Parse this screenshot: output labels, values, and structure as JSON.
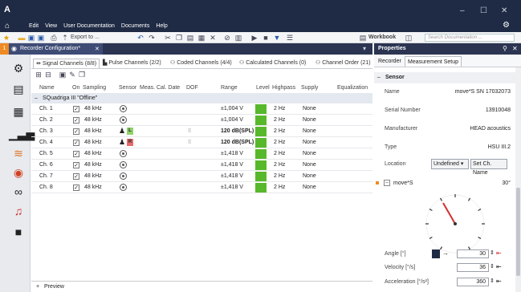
{
  "window": {
    "minimize": "–",
    "maximize": "☐",
    "close": "✕",
    "logo": "A"
  },
  "menu": {
    "items": [
      "Edit",
      "View",
      "User Documentation",
      "Documents",
      "Help"
    ]
  },
  "toolbar": {
    "export_label": "Export to ...",
    "workbook_label": "Workbook",
    "search_placeholder": "Search Documentation ..."
  },
  "doc_tab": {
    "number": "1",
    "title": "Recorder Configuration*",
    "close": "✕"
  },
  "channel_tabs": [
    "Signal Channels (8/8)",
    "Pulse Channels (2/2)",
    "Coded Channels (4/4)",
    "Calculated Channels (0)",
    "Channel Order (21)"
  ],
  "table": {
    "headers": [
      "Name",
      "On",
      "Sampling",
      "Sensor",
      "Meas. Cal. Date",
      "DOF",
      "Range",
      "Level",
      "Highpass",
      "Supply",
      "Equalization"
    ],
    "group": "SQuadriga III \"Offline\"",
    "rows": [
      {
        "name": "Ch. 1",
        "sampling": "48 kHz",
        "range": "±1,004 V",
        "highpass": "2 Hz",
        "supply": "None"
      },
      {
        "name": "Ch. 2",
        "sampling": "48 kHz",
        "range": "±1,004 V",
        "highpass": "2 Hz",
        "supply": "None"
      },
      {
        "name": "Ch. 3",
        "sampling": "48 kHz",
        "range": "120 dB(SPL)",
        "highpass": "2 Hz",
        "supply": "None",
        "badge": "L"
      },
      {
        "name": "Ch. 4",
        "sampling": "48 kHz",
        "range": "120 dB(SPL)",
        "highpass": "2 Hz",
        "supply": "None",
        "badge": "R"
      },
      {
        "name": "Ch. 5",
        "sampling": "48 kHz",
        "range": "±1,418 V",
        "highpass": "2 Hz",
        "supply": "None"
      },
      {
        "name": "Ch. 6",
        "sampling": "48 kHz",
        "range": "±1,418 V",
        "highpass": "2 Hz",
        "supply": "None"
      },
      {
        "name": "Ch. 7",
        "sampling": "48 kHz",
        "range": "±1,418 V",
        "highpass": "2 Hz",
        "supply": "None"
      },
      {
        "name": "Ch. 8",
        "sampling": "48 kHz",
        "range": "±1,418 V",
        "highpass": "2 Hz",
        "supply": "None"
      }
    ]
  },
  "preview_label": "Preview",
  "properties": {
    "title": "Properties",
    "tabs": [
      "Recorder",
      "Measurement Setup"
    ],
    "section": "Sensor",
    "name_label": "Name",
    "name_value": "move*S SN 17032073",
    "serial_label": "Serial Number",
    "serial_value": "13910048",
    "manufacturer_label": "Manufacturer",
    "manufacturer_value": "HEAD acoustics",
    "type_label": "Type",
    "type_value": "HSU III.2",
    "location_label": "Location",
    "location_value": "Undefined",
    "set_button": "Set Ch. Name",
    "device_label": "move*S",
    "device_value": "30°",
    "dial_angle_deg": 30,
    "angle_label": "Angle [°]",
    "angle_value": "30",
    "velocity_label": "Velocity [°/s]",
    "velocity_value": "36",
    "accel_label": "Acceleration [°/s²]",
    "accel_value": "360"
  },
  "colors": {
    "titlebar": "#1f2a44",
    "accent_orange": "#f08a24",
    "level_green": "#58b82c",
    "needle_red": "#d13030"
  }
}
